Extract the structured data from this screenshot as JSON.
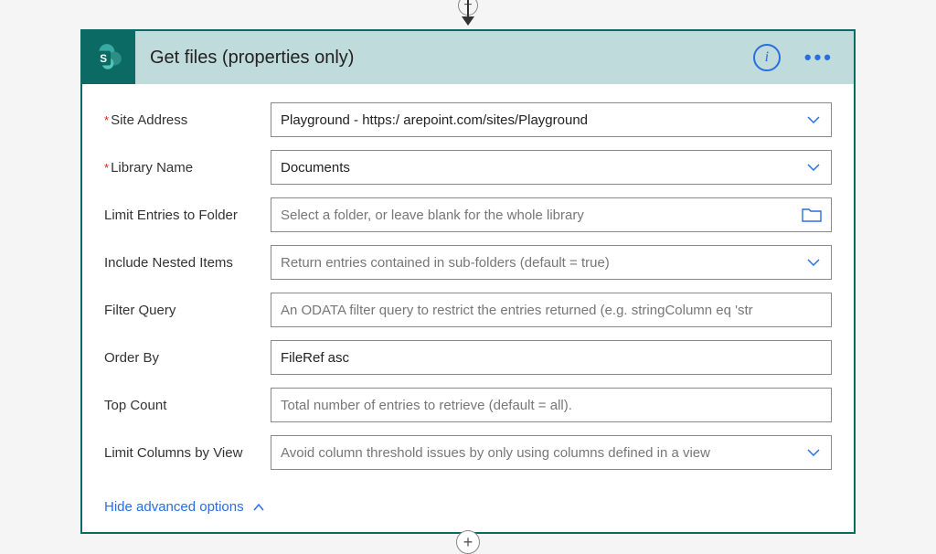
{
  "header": {
    "title": "Get files (properties only)",
    "info_tooltip": "i",
    "more": "• • •"
  },
  "fields": {
    "site_address": {
      "label": "Site Address",
      "required": true,
      "value": "Playground - https:/                         arepoint.com/sites/Playground",
      "kind": "select"
    },
    "library_name": {
      "label": "Library Name",
      "required": true,
      "value": "Documents",
      "kind": "select"
    },
    "limit_folder": {
      "label": "Limit Entries to Folder",
      "required": false,
      "placeholder": "Select a folder, or leave blank for the whole library",
      "kind": "folder"
    },
    "include_nested": {
      "label": "Include Nested Items",
      "required": false,
      "placeholder": "Return entries contained in sub-folders (default = true)",
      "kind": "select"
    },
    "filter_query": {
      "label": "Filter Query",
      "required": false,
      "placeholder": "An ODATA filter query to restrict the entries returned (e.g. stringColumn eq 'str",
      "kind": "text"
    },
    "order_by": {
      "label": "Order By",
      "required": false,
      "value": "FileRef asc",
      "kind": "text"
    },
    "top_count": {
      "label": "Top Count",
      "required": false,
      "placeholder": "Total number of entries to retrieve (default = all).",
      "kind": "text"
    },
    "limit_columns": {
      "label": "Limit Columns by View",
      "required": false,
      "placeholder": "Avoid column threshold issues by only using columns defined in a view",
      "kind": "select"
    }
  },
  "advanced_toggle": "Hide advanced options",
  "icons": {
    "plus": "+"
  }
}
